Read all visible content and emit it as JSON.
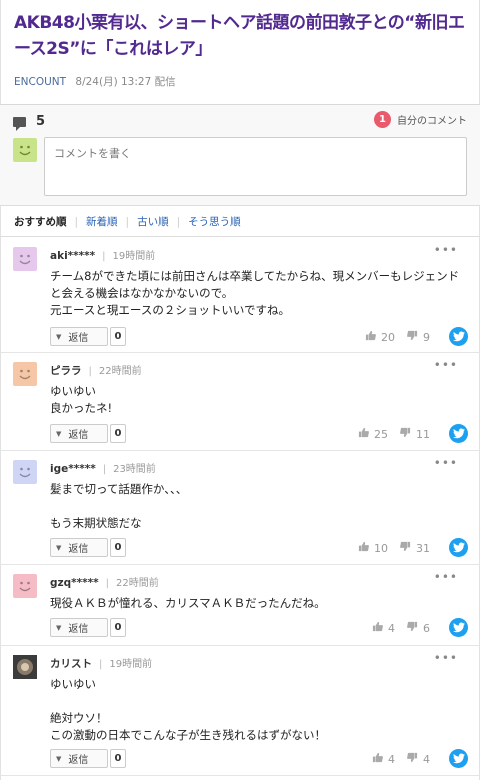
{
  "article": {
    "title": "AKB48小栗有以、ショートヘア話題の前田敦子との“新旧エース2S”に「これはレア」",
    "source": "ENCOUNT",
    "date": "8/24(月) 13:27 配信"
  },
  "comments_header": {
    "count": "5",
    "my_comments_badge": "1",
    "my_comments_label": "自分のコメント",
    "compose_placeholder": "コメントを書く"
  },
  "sort_tabs": [
    {
      "label": "おすすめ順",
      "active": true
    },
    {
      "label": "新着順",
      "active": false
    },
    {
      "label": "古い順",
      "active": false
    },
    {
      "label": "そう思う順",
      "active": false
    }
  ],
  "reply_label": "返信",
  "comments": [
    {
      "user": "aki*****",
      "time": "19時間前",
      "body": "チーム8ができた頃には前田さんは卒業してたからね、現メンバーもレジェンドと会える機会はなかなかないので。\n元エースと現エースの２ショットいいですね。",
      "replies": "0",
      "likes": "20",
      "dislikes": "9",
      "avatar_color": "#e6c8ec"
    },
    {
      "user": "ピララ",
      "time": "22時間前",
      "body": "ゆいゆい\n良かったネ!",
      "replies": "0",
      "likes": "25",
      "dislikes": "11",
      "avatar_color": "#f5c7a7"
    },
    {
      "user": "ige*****",
      "time": "23時間前",
      "body": "髪まで切って話題作か、、、\n\nもう末期状態だな",
      "replies": "0",
      "likes": "10",
      "dislikes": "31",
      "avatar_color": "#cfd5f5"
    },
    {
      "user": "gzq*****",
      "time": "22時間前",
      "body": "現役ＡＫＢが憧れる、カリスマＡＫＢだったんだね。",
      "replies": "0",
      "likes": "4",
      "dislikes": "6",
      "avatar_color": "#f5bcc6"
    },
    {
      "user": "カリスト",
      "time": "19時間前",
      "body": "ゆいゆい\n\n絶対ウソ！\nこの激動の日本でこんな子が生き残れるはずがない！",
      "replies": "0",
      "likes": "4",
      "dislikes": "4",
      "avatar_color": "#5a5a5a"
    }
  ]
}
